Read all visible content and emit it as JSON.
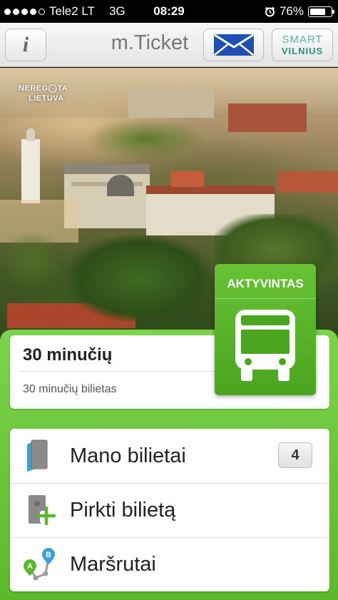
{
  "status_bar": {
    "carrier": "Tele2 LT",
    "network": "3G",
    "time": "08:29",
    "battery": "76%",
    "battery_level": 0.76
  },
  "header": {
    "info_label": "i",
    "title": "m.Ticket",
    "mail_icon": "envelope-icon",
    "brand_line1": "SMART",
    "brand_line2": "VILNIUS"
  },
  "hero": {
    "watermark_line1": "NEREG",
    "watermark_line2": "TA",
    "watermark_line3": "LIETUVA"
  },
  "ticket": {
    "title": "30 minučių",
    "subtitle": "30 minučių bilietas",
    "status_label": "AKTYVINTAS",
    "status_icon": "bus-icon"
  },
  "menu": {
    "items": [
      {
        "label": "Mano bilietai",
        "icon": "tickets-icon",
        "count": "4"
      },
      {
        "label": "Pirkti bilietą",
        "icon": "buy-ticket-icon"
      },
      {
        "label": "Maršrutai",
        "icon": "route-icon"
      }
    ]
  },
  "colors": {
    "accent_green": "#5cb82b",
    "brand_teal": "#2f8f7f",
    "mail_blue": "#1e4fb3"
  }
}
